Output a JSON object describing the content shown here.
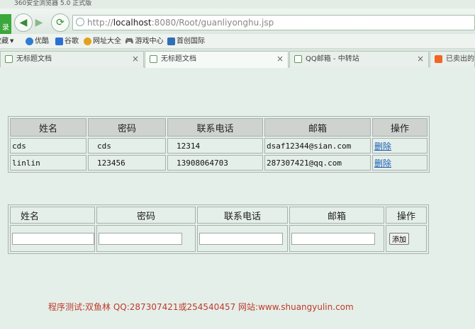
{
  "browser": {
    "title": "360安全浏览器 5.0 正式版",
    "logo_label": "录",
    "url_prefix": "http://",
    "url_host": "localhost",
    "url_rest": ":8080/Root/guanliyonghu.jsp"
  },
  "bookmarks": [
    {
      "label": "收藏",
      "color": "#777777"
    },
    {
      "label": "优酷",
      "color": "#2f7cd3"
    },
    {
      "label": "谷歌",
      "color": "#2b6fd6"
    },
    {
      "label": "网址大全",
      "color": "#e3a21a"
    },
    {
      "label": "游戏中心",
      "color": "#7c6a5a"
    },
    {
      "label": "首创国际",
      "color": "#2f6fb5"
    }
  ],
  "tabs": [
    {
      "label": "无标题文档",
      "close": "×"
    },
    {
      "label": "无标题文档",
      "close": "×"
    },
    {
      "label": "QQ邮箱 - 中转站",
      "close": "×"
    },
    {
      "label": "已卖出的宝",
      "close": ""
    }
  ],
  "users_table": {
    "headers": [
      "姓名",
      "密码",
      "联系电话",
      "邮箱",
      "操作"
    ],
    "rows": [
      {
        "name": "cds",
        "password": "cds",
        "phone": "12314",
        "email": "dsaf12344@sian.com",
        "action": "删除"
      },
      {
        "name": "linlin",
        "password": "123456",
        "phone": "13908064703",
        "email": "287307421@qq.com",
        "action": "删除"
      }
    ]
  },
  "add_table": {
    "headers": [
      "姓名",
      "密码",
      "联系电话",
      "邮箱",
      "操作"
    ],
    "name_value": "",
    "password_value": "",
    "phone_value": "",
    "email_value": "",
    "add_label": "添加"
  },
  "footer": "程序测试:双鱼林 QQ:287307421或254540457 网站:www.shuangyulin.com"
}
